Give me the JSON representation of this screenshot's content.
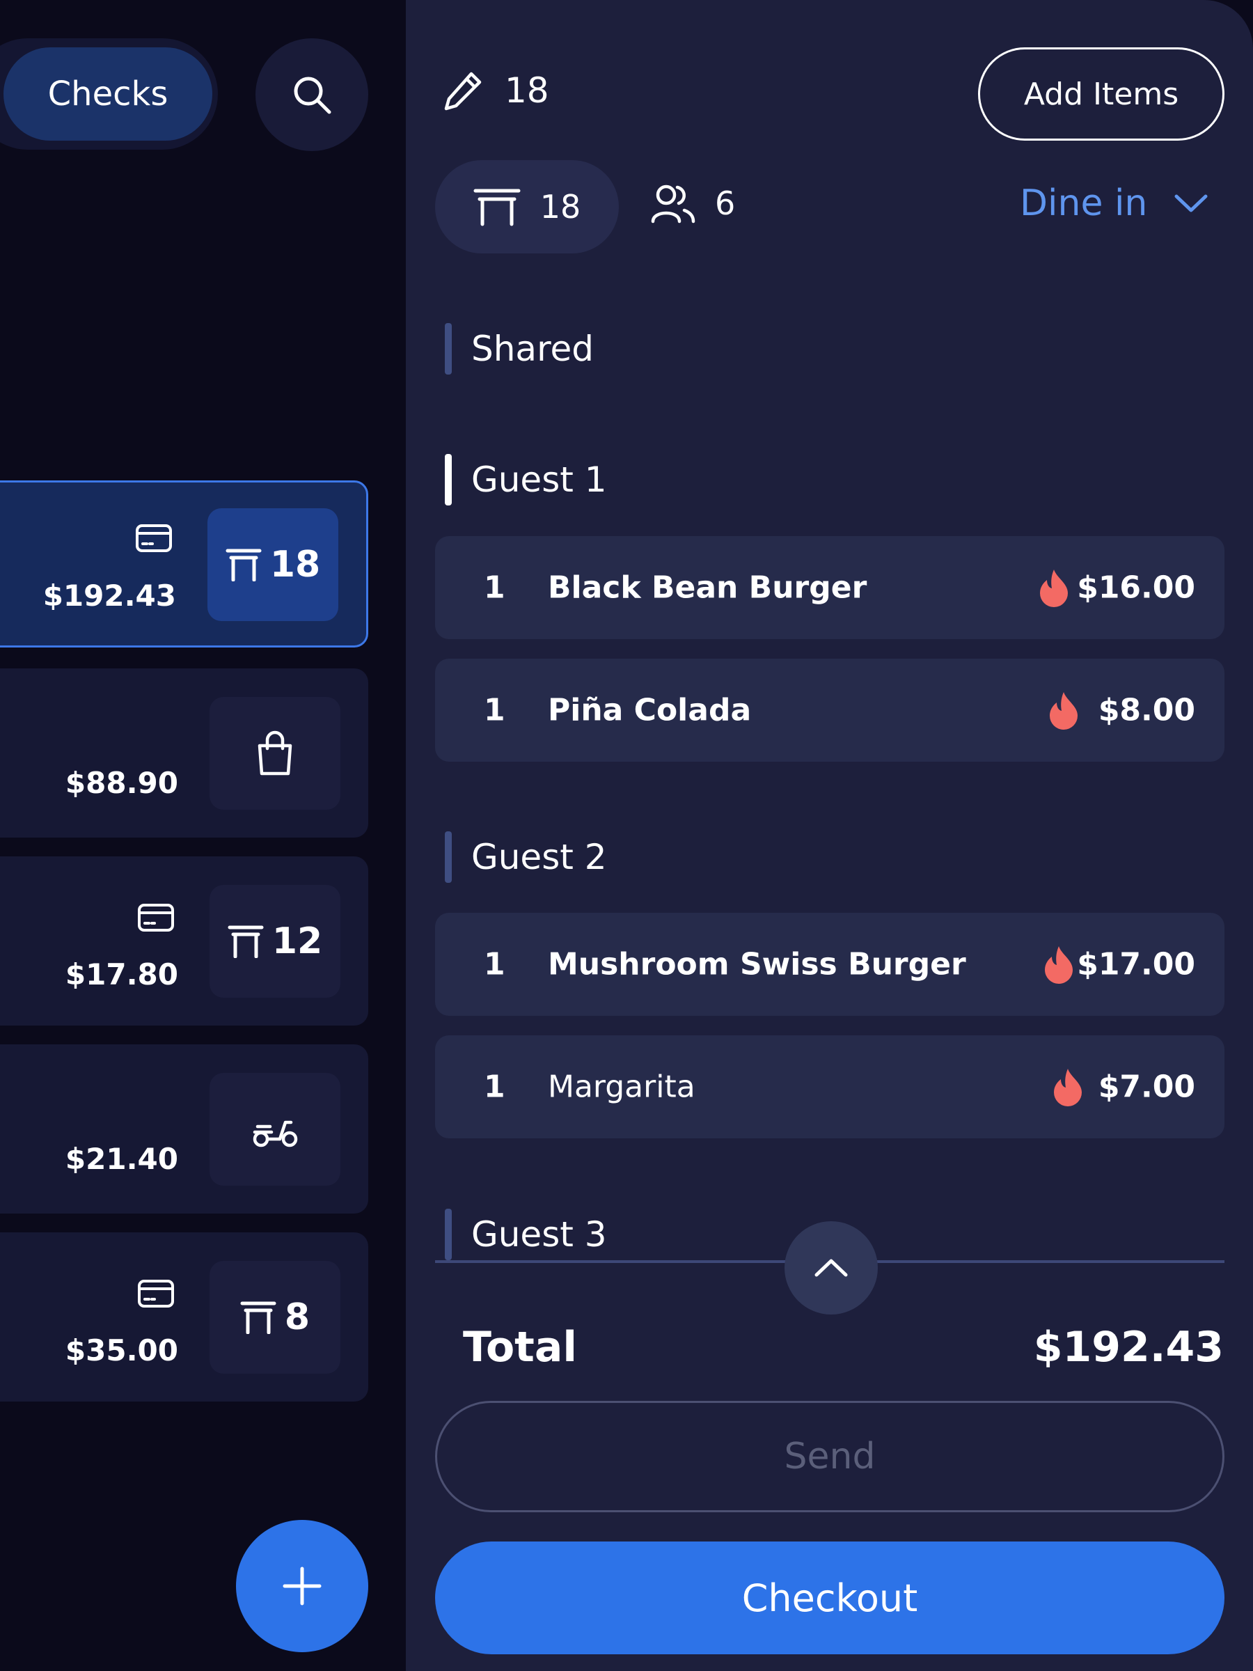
{
  "colors": {
    "accent": "#2d73e8",
    "fire": "#f36a64",
    "dine_in": "#5f95ee",
    "selected_border": "#3d78e8"
  },
  "left": {
    "segment_active_label": "Checks",
    "checks": [
      {
        "amount": "$192.43",
        "payment_icon": "card-icon",
        "badge_icon": "table-icon",
        "badge_text": "18",
        "selected": true
      },
      {
        "amount": "$88.90",
        "payment_icon": "",
        "badge_icon": "bag-icon",
        "badge_text": "",
        "selected": false
      },
      {
        "amount": "$17.80",
        "payment_icon": "card-icon",
        "badge_icon": "table-icon",
        "badge_text": "12",
        "selected": false
      },
      {
        "amount": "$21.40",
        "payment_icon": "",
        "badge_icon": "scooter-icon",
        "badge_text": "",
        "selected": false
      },
      {
        "amount": "$35.00",
        "payment_icon": "card-icon",
        "badge_icon": "table-icon",
        "badge_text": "8",
        "selected": false
      }
    ]
  },
  "order": {
    "name": "18",
    "add_items_label": "Add Items",
    "table_number": "18",
    "guest_count": "6",
    "order_type": "Dine in",
    "sections": {
      "shared": "Shared",
      "guest1": "Guest 1",
      "guest2": "Guest 2",
      "guest3": "Guest 3"
    },
    "items": {
      "g1_1": {
        "qty": "1",
        "name": "Black Bean Burger",
        "price": "$16.00"
      },
      "g1_2": {
        "qty": "1",
        "name": "Piña Colada",
        "price": "$8.00"
      },
      "g2_1": {
        "qty": "1",
        "name": "Mushroom Swiss Burger",
        "price": "$17.00"
      },
      "g2_2": {
        "qty": "1",
        "name": "Margarita",
        "price": "$7.00"
      }
    },
    "total_label": "Total",
    "total_value": "$192.43",
    "send_label": "Send",
    "checkout_label": "Checkout"
  }
}
